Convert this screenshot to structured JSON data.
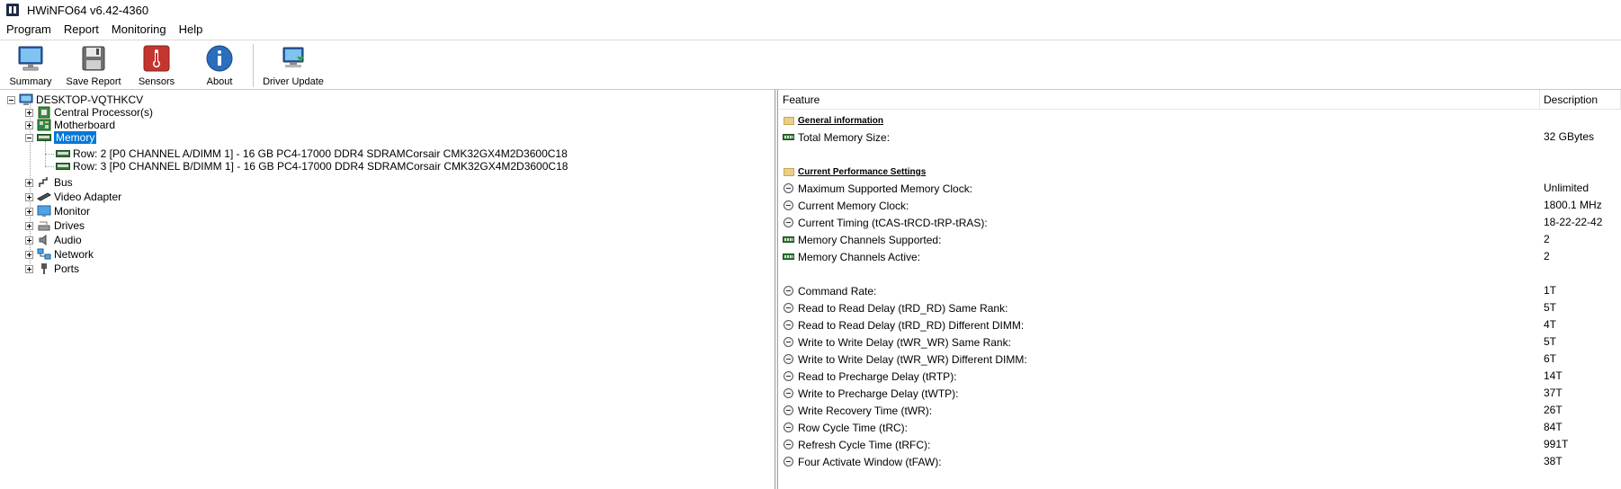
{
  "window": {
    "title": "HWiNFO64 v6.42-4360"
  },
  "menu": [
    "Program",
    "Report",
    "Monitoring",
    "Help"
  ],
  "toolbar": {
    "summary": "Summary",
    "save_report": "Save Report",
    "sensors": "Sensors",
    "about": "About",
    "driver_update": "Driver Update"
  },
  "tree": {
    "root": "DESKTOP-VQTHKCV",
    "items": [
      "Central Processor(s)",
      "Motherboard",
      "Memory",
      "Row: 2 [P0 CHANNEL A/DIMM 1] - 16 GB PC4-17000 DDR4 SDRAMCorsair CMK32GX4M2D3600C18",
      "Row: 3 [P0 CHANNEL B/DIMM 1] - 16 GB PC4-17000 DDR4 SDRAMCorsair CMK32GX4M2D3600C18",
      "Bus",
      "Video Adapter",
      "Monitor",
      "Drives",
      "Audio",
      "Network",
      "Ports"
    ]
  },
  "details": {
    "headers": {
      "feature": "Feature",
      "description": "Description"
    },
    "rows": [
      {
        "feature": "General information",
        "value": ""
      },
      {
        "feature": "Total Memory Size:",
        "value": "32 GBytes"
      },
      {
        "feature": "Current Performance Settings",
        "value": ""
      },
      {
        "feature": "Maximum Supported Memory Clock:",
        "value": "Unlimited"
      },
      {
        "feature": "Current Memory Clock:",
        "value": "1800.1 MHz"
      },
      {
        "feature": "Current Timing (tCAS-tRCD-tRP-tRAS):",
        "value": "18-22-22-42"
      },
      {
        "feature": "Memory Channels Supported:",
        "value": "2"
      },
      {
        "feature": "Memory Channels Active:",
        "value": "2"
      },
      {
        "feature": "Command Rate:",
        "value": "1T"
      },
      {
        "feature": "Read to Read Delay (tRD_RD) Same Rank:",
        "value": "5T"
      },
      {
        "feature": "Read to Read Delay (tRD_RD) Different DIMM:",
        "value": "4T"
      },
      {
        "feature": "Write to Write Delay (tWR_WR) Same Rank:",
        "value": "5T"
      },
      {
        "feature": "Write to Write Delay (tWR_WR) Different DIMM:",
        "value": "6T"
      },
      {
        "feature": "Read to Precharge Delay (tRTP):",
        "value": "14T"
      },
      {
        "feature": "Write to Precharge Delay (tWTP):",
        "value": "37T"
      },
      {
        "feature": "Write Recovery Time (tWR):",
        "value": "26T"
      },
      {
        "feature": "Row Cycle Time (tRC):",
        "value": "84T"
      },
      {
        "feature": "Refresh Cycle Time (tRFC):",
        "value": "991T"
      },
      {
        "feature": "Four Activate Window (tFAW):",
        "value": "38T"
      }
    ]
  }
}
